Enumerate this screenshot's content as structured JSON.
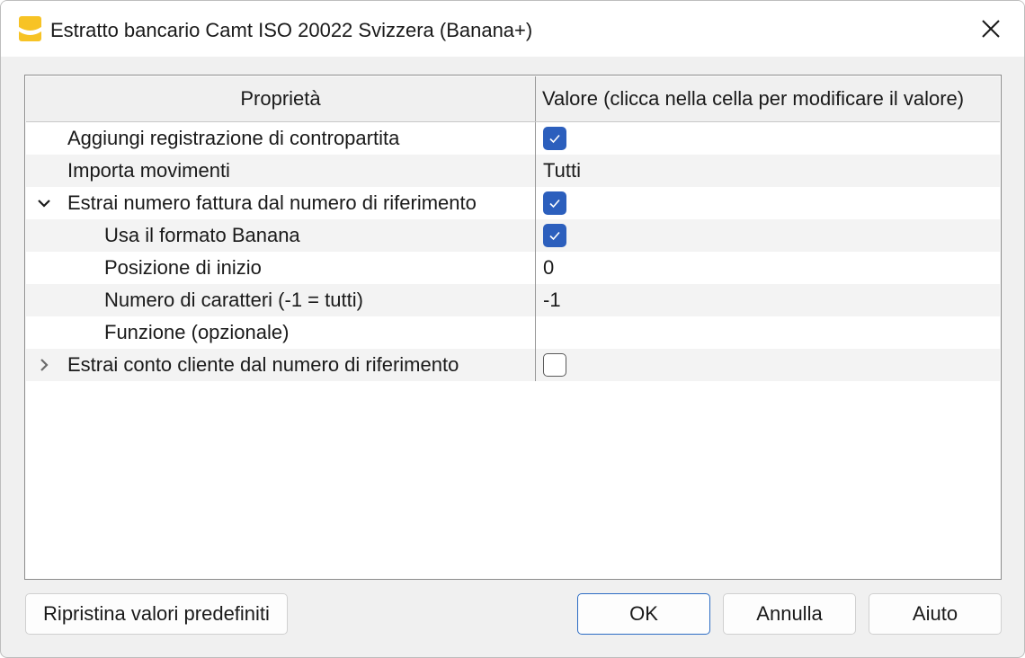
{
  "window": {
    "title": "Estratto bancario Camt ISO 20022 Svizzera (Banana+)",
    "app_icon": "banana-app-icon",
    "close_icon": "close-icon"
  },
  "grid": {
    "headers": {
      "property": "Proprietà",
      "value": "Valore (clicca nella cella per modificare il valore)"
    },
    "rows": [
      {
        "label": "Aggiungi registrazione di contropartita",
        "level": 0,
        "expander": "none",
        "value_type": "checkbox",
        "checked": true,
        "value": ""
      },
      {
        "label": "Importa movimenti",
        "level": 0,
        "expander": "none",
        "value_type": "text",
        "value": "Tutti"
      },
      {
        "label": "Estrai numero fattura dal numero di riferimento",
        "level": 0,
        "expander": "expanded",
        "value_type": "checkbox",
        "checked": true,
        "value": ""
      },
      {
        "label": "Usa il formato Banana",
        "level": 1,
        "expander": "none",
        "value_type": "checkbox",
        "checked": true,
        "value": ""
      },
      {
        "label": "Posizione di inizio",
        "level": 1,
        "expander": "none",
        "value_type": "text",
        "value": "0"
      },
      {
        "label": "Numero di caratteri (-1 = tutti)",
        "level": 1,
        "expander": "none",
        "value_type": "text",
        "value": "-1"
      },
      {
        "label": "Funzione (opzionale)",
        "level": 1,
        "expander": "none",
        "value_type": "text",
        "value": ""
      },
      {
        "label": "Estrai conto cliente dal numero di riferimento",
        "level": 0,
        "expander": "collapsed",
        "value_type": "checkbox",
        "checked": false,
        "value": ""
      }
    ]
  },
  "buttons": {
    "reset": "Ripristina valori predefiniti",
    "ok": "OK",
    "cancel": "Annulla",
    "help": "Aiuto"
  },
  "colors": {
    "accent": "#2c5fbd",
    "icon_yellow": "#f7c325",
    "alt_row": "#f3f3f3"
  }
}
